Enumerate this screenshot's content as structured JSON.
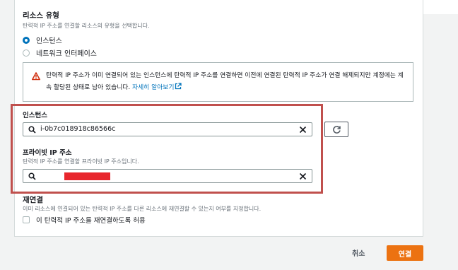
{
  "resource_type": {
    "title": "리소스 유형",
    "description": "탄력적 IP 주소를 연결할 리소스의 유형을 선택합니다.",
    "options": [
      {
        "label": "인스턴스",
        "checked": true
      },
      {
        "label": "네트워크 인터페이스",
        "checked": false
      }
    ]
  },
  "alert": {
    "text": "탄력적 IP 주소가 이미 연결되어 있는 인스턴스에 탄력적 IP 주소를 연결하면 이전에 연결된 탄력적 IP 주소가 연결 해제되지만 계정에는 계속 할당된 상태로 남아 있습니다.",
    "link": "자세히 알아보기"
  },
  "instance": {
    "label": "인스턴스",
    "value": "i-0b7c018918c86566c"
  },
  "private_ip": {
    "label": "프라이빗 IP 주소",
    "description": "탄력적 IP 주소를 연결할 프라이빗 IP 주소입니다."
  },
  "reassociation": {
    "title": "재연결",
    "description": "이미 리소스에 연결되어 있는 탄력적 IP 주소를 다른 리소스에 재연결할 수 있는지 여부를 지정합니다.",
    "checkbox_label": "이 탄력적 IP 주소를 재연결하도록 허용"
  },
  "footer": {
    "cancel": "취소",
    "connect": "연결"
  },
  "colors": {
    "accent": "#0073bb",
    "primary_button": "#ec7211",
    "highlight_border": "#c0504d",
    "redaction": "#e8262d"
  }
}
